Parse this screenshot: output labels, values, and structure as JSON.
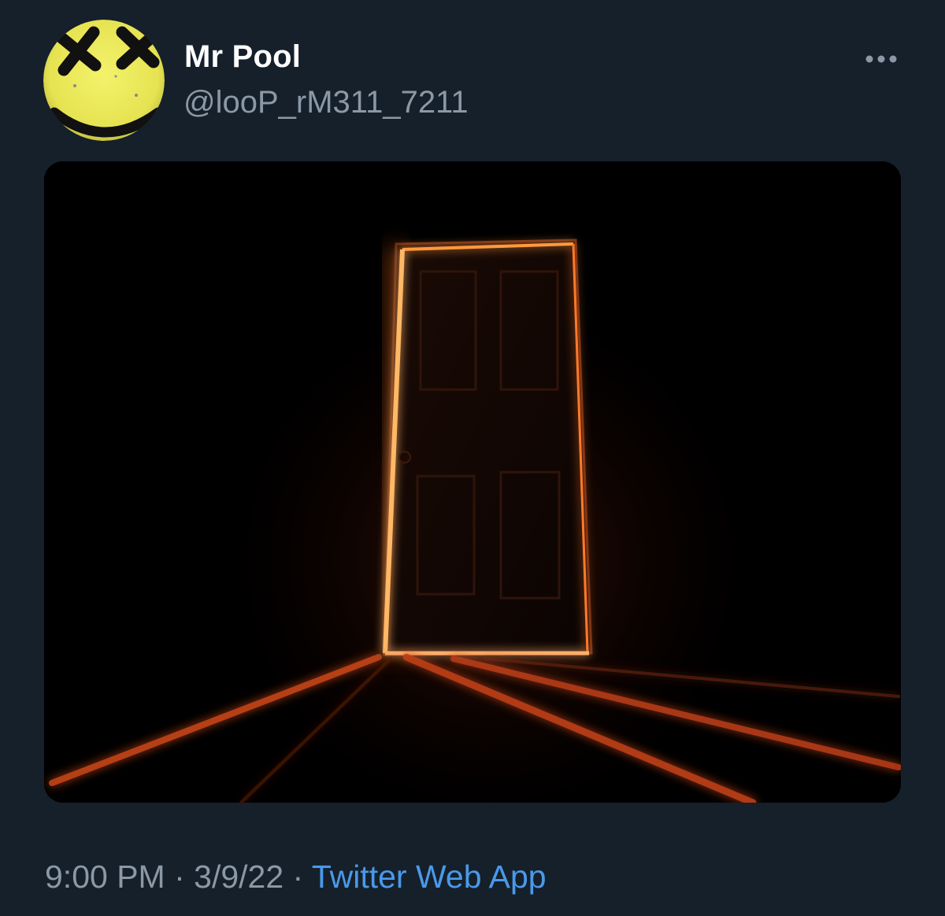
{
  "tweet": {
    "display_name": "Mr Pool",
    "handle": "@looP_rM311_7211",
    "time": "9:00 PM",
    "separator": " · ",
    "date": "3/9/22",
    "source": "Twitter Web App"
  },
  "avatar": {
    "icon": "smiley-face-x-eyes-icon",
    "face_color": "#f0ee5e"
  },
  "more_menu": {
    "icon": "more-horizontal-icon"
  },
  "media": {
    "kind": "photo",
    "glow_color": "#ff7a2a"
  },
  "colors": {
    "background": "#15202b",
    "primary_text": "#ffffff",
    "secondary_text": "#8b98a5",
    "link": "#4a99e9"
  }
}
